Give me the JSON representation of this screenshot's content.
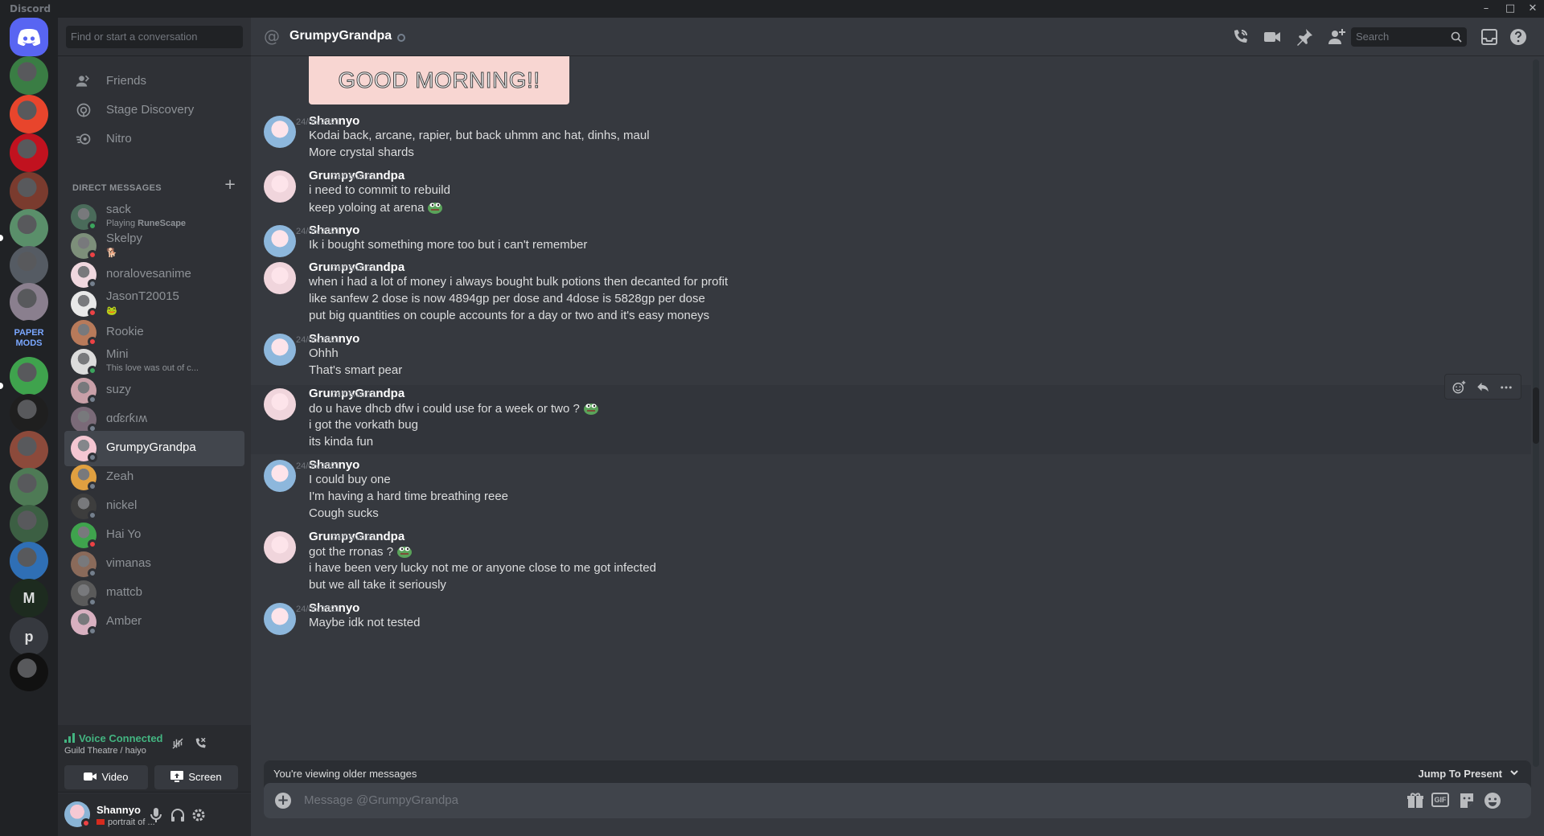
{
  "window": {
    "title": "Discord"
  },
  "dm_sidebar": {
    "search_placeholder": "Find or start a conversation",
    "nav": [
      {
        "label": "Friends",
        "icon": "friends-icon"
      },
      {
        "label": "Stage Discovery",
        "icon": "stage-icon"
      },
      {
        "label": "Nitro",
        "icon": "nitro-icon"
      }
    ],
    "section_title": "DIRECT MESSAGES",
    "dms": [
      {
        "name": "sack",
        "activity_prefix": "Playing ",
        "activity": "RuneScape",
        "status": "online"
      },
      {
        "name": "Skelpy",
        "activity": "🐕",
        "status": "dnd"
      },
      {
        "name": "noralovesanime",
        "status": "offline"
      },
      {
        "name": "JasonT20015",
        "activity": "🐸",
        "status": "dnd"
      },
      {
        "name": "Rookie",
        "status": "dnd"
      },
      {
        "name": "Mini",
        "activity": "This love was out of c...",
        "status": "online"
      },
      {
        "name": "suzy",
        "status": "offline"
      },
      {
        "name": "ɑɗɛɾƙıʍ",
        "status": "offline"
      },
      {
        "name": "GrumpyGrandpa",
        "status": "offline",
        "active": true
      },
      {
        "name": "Zeah",
        "status": "offline"
      },
      {
        "name": "nickel",
        "status": "offline"
      },
      {
        "name": "Hai Yo",
        "status": "dnd"
      },
      {
        "name": "vimanas",
        "status": "offline"
      },
      {
        "name": "mattcb",
        "status": "offline"
      },
      {
        "name": "Amber",
        "status": "offline"
      }
    ],
    "voice": {
      "title": "Voice Connected",
      "channel": "Guild Theatre / haiyo",
      "video_label": "Video",
      "screen_label": "Screen"
    },
    "user": {
      "name": "Shannyo",
      "status_text": "portrait of ..."
    }
  },
  "chat": {
    "recipient": "GrumpyGrandpa",
    "search_placeholder": "Search",
    "image_text": "GOOD MORNING!!",
    "messages": [
      {
        "author": "Shannyo",
        "timestamp": "24/06/2021",
        "lines": [
          "Kodai back,  arcane, rapier, but back uhmm anc hat, dinhs, maul",
          "More crystal shards"
        ]
      },
      {
        "author": "GrumpyGrandpa",
        "timestamp": "24/06/2021",
        "lines": [
          "i need to commit to rebuild",
          "keep yoloing at arena"
        ]
      },
      {
        "author": "Shannyo",
        "timestamp": "24/06/2021",
        "lines": [
          "Ik i bought something more too but i can't remember"
        ]
      },
      {
        "author": "GrumpyGrandpa",
        "timestamp": "24/06/2021",
        "lines": [
          "when i had a lot of money i always bought bulk potions then decanted for profit",
          "like sanfew 2 dose is now 4894gp per dose and 4dose is 5828gp per dose",
          "put big quantities on couple accounts for a day or two and it's easy moneys"
        ]
      },
      {
        "author": "Shannyo",
        "timestamp": "24/06/2021",
        "lines": [
          "Ohhh",
          "That's smart pear"
        ]
      },
      {
        "author": "GrumpyGrandpa",
        "timestamp": "24/06/2021",
        "lines": [
          "do u have dhcb dfw i could use for a week or two ?",
          "i got the vorkath bug",
          "its kinda fun"
        ]
      },
      {
        "author": "Shannyo",
        "timestamp": "24/06/2021",
        "lines": [
          "I could buy one",
          "I'm having a hard time breathing reee",
          "Cough sucks"
        ]
      },
      {
        "author": "GrumpyGrandpa",
        "timestamp": "24/06/2021",
        "lines": [
          "got the rronas ?",
          "i have been very lucky not me or anyone close to me got infected",
          "but we all take it seriously"
        ]
      },
      {
        "author": "Shannyo",
        "timestamp": "24/06/2021",
        "lines": [
          "Maybe idk not tested"
        ]
      }
    ],
    "older_notice": "You're viewing older messages",
    "jump_label": "Jump To Present",
    "composer_placeholder": "Message @GrumpyGrandpa",
    "gif_label": "GIF"
  },
  "guilds": [
    {
      "name": "home-discord",
      "color": "#5865f2"
    },
    {
      "name": "pepe-server",
      "color": "#3a7d44"
    },
    {
      "name": "no-sign-server",
      "color": "#e8452c"
    },
    {
      "name": "red-wolf-server",
      "color": "#c1121f"
    },
    {
      "name": "face-server",
      "color": "#7a3b2e"
    },
    {
      "name": "anime-server",
      "color": "#5a8f6a"
    },
    {
      "name": "wdr-server",
      "color": "#555b63"
    },
    {
      "name": "anime-duo-server",
      "color": "#8a7f8e"
    },
    {
      "name": "paper-mods-server",
      "text": "PAPER MODS",
      "color": "#202225"
    },
    {
      "name": "voice-server",
      "color": "#3fa34d"
    },
    {
      "name": "helmet-server",
      "color": "#1f1f1f"
    },
    {
      "name": "sunset-server",
      "color": "#8c4a3b"
    },
    {
      "name": "sword-server",
      "color": "#4e7a55"
    },
    {
      "name": "forest-server",
      "color": "#3c5f43"
    },
    {
      "name": "frog-blue-server",
      "color": "#2f6fb5"
    },
    {
      "name": "m-server",
      "text": "M",
      "color": "#1d2b1f"
    },
    {
      "name": "p-server",
      "text": "p",
      "color": "#36393f"
    },
    {
      "name": "mafia-server",
      "color": "#111111"
    }
  ],
  "colors": {
    "accent": "#5865f2",
    "online": "#3ba55d",
    "dnd": "#ed4245",
    "offline": "#747f8d",
    "voice": "#43b581"
  }
}
